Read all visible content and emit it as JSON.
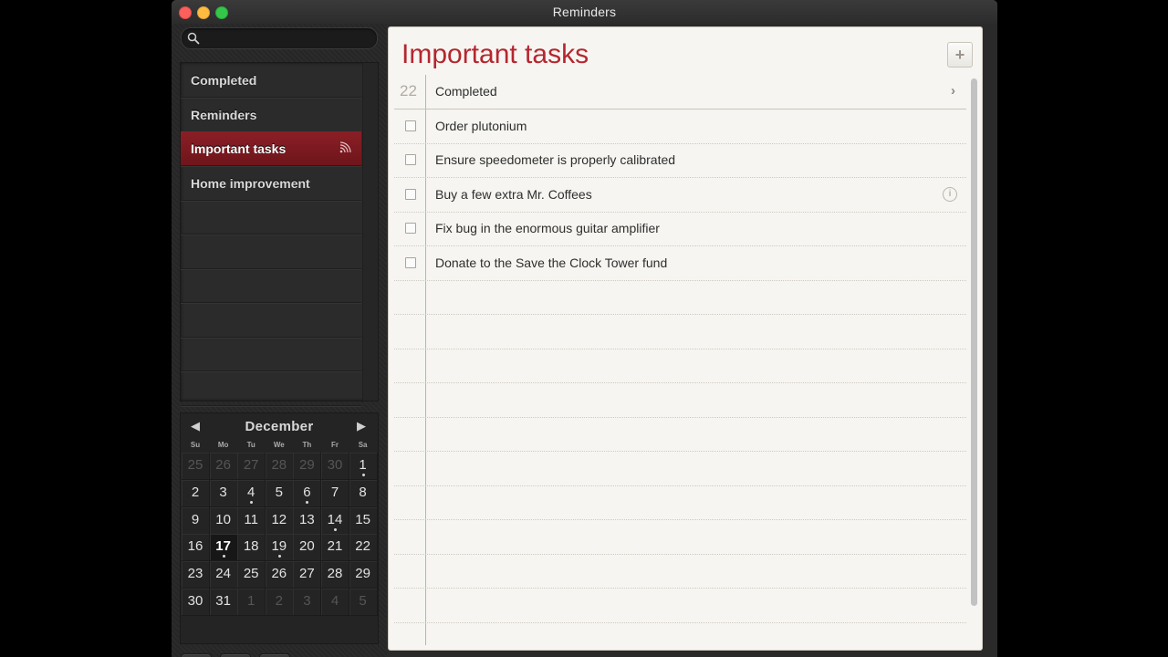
{
  "window": {
    "title": "Reminders"
  },
  "search": {
    "placeholder": ""
  },
  "lists": [
    {
      "label": "Completed",
      "selected": false
    },
    {
      "label": "Reminders",
      "selected": false
    },
    {
      "label": "Important tasks",
      "selected": true,
      "shared": true
    },
    {
      "label": "Home improvement",
      "selected": false
    }
  ],
  "calendar": {
    "month": "December",
    "weekdays": [
      "Su",
      "Mo",
      "Tu",
      "We",
      "Th",
      "Fr",
      "Sa"
    ],
    "weeks": [
      [
        {
          "d": "25",
          "o": true
        },
        {
          "d": "26",
          "o": true
        },
        {
          "d": "27",
          "o": true
        },
        {
          "d": "28",
          "o": true
        },
        {
          "d": "29",
          "o": true
        },
        {
          "d": "30",
          "o": true
        },
        {
          "d": "1",
          "dot": true
        }
      ],
      [
        {
          "d": "2"
        },
        {
          "d": "3"
        },
        {
          "d": "4",
          "dot": true
        },
        {
          "d": "5"
        },
        {
          "d": "6",
          "dot": true
        },
        {
          "d": "7"
        },
        {
          "d": "8"
        }
      ],
      [
        {
          "d": "9"
        },
        {
          "d": "10"
        },
        {
          "d": "11"
        },
        {
          "d": "12"
        },
        {
          "d": "13"
        },
        {
          "d": "14",
          "dot": true
        },
        {
          "d": "15"
        }
      ],
      [
        {
          "d": "16"
        },
        {
          "d": "17",
          "today": true,
          "dot": true
        },
        {
          "d": "18"
        },
        {
          "d": "19",
          "dot": true
        },
        {
          "d": "20"
        },
        {
          "d": "21"
        },
        {
          "d": "22"
        }
      ],
      [
        {
          "d": "23"
        },
        {
          "d": "24"
        },
        {
          "d": "25"
        },
        {
          "d": "26"
        },
        {
          "d": "27"
        },
        {
          "d": "28"
        },
        {
          "d": "29"
        }
      ],
      [
        {
          "d": "30"
        },
        {
          "d": "31"
        },
        {
          "d": "1",
          "o": true
        },
        {
          "d": "2",
          "o": true
        },
        {
          "d": "3",
          "o": true
        },
        {
          "d": "4",
          "o": true
        },
        {
          "d": "5",
          "o": true
        }
      ]
    ]
  },
  "main": {
    "title": "Important tasks",
    "completed": {
      "count": "22",
      "label": "Completed"
    },
    "tasks": [
      {
        "text": "Order plutonium",
        "info": false
      },
      {
        "text": "Ensure speedometer is properly calibrated",
        "info": false
      },
      {
        "text": "Buy a few extra Mr. Coffees",
        "info": true
      },
      {
        "text": "Fix bug in the enormous guitar amplifier",
        "info": false
      },
      {
        "text": "Donate to the Save the Clock Tower fund",
        "info": false
      }
    ],
    "empty_rows": 11
  },
  "icons": {
    "search": "search-icon",
    "share": "shared-list-icon",
    "prev": "previous-month-icon",
    "next": "next-month-icon",
    "info": "info-icon",
    "chevron": "chevron-right-icon",
    "sidebar_toggle": "show-sidebar-icon",
    "calendar_toggle": "calendar-icon",
    "add": "plus-icon"
  },
  "colors": {
    "accent": "#b5262f",
    "selected": "#7b1a21",
    "paper": "#f6f5f1",
    "margin": "#ef9aa0"
  }
}
